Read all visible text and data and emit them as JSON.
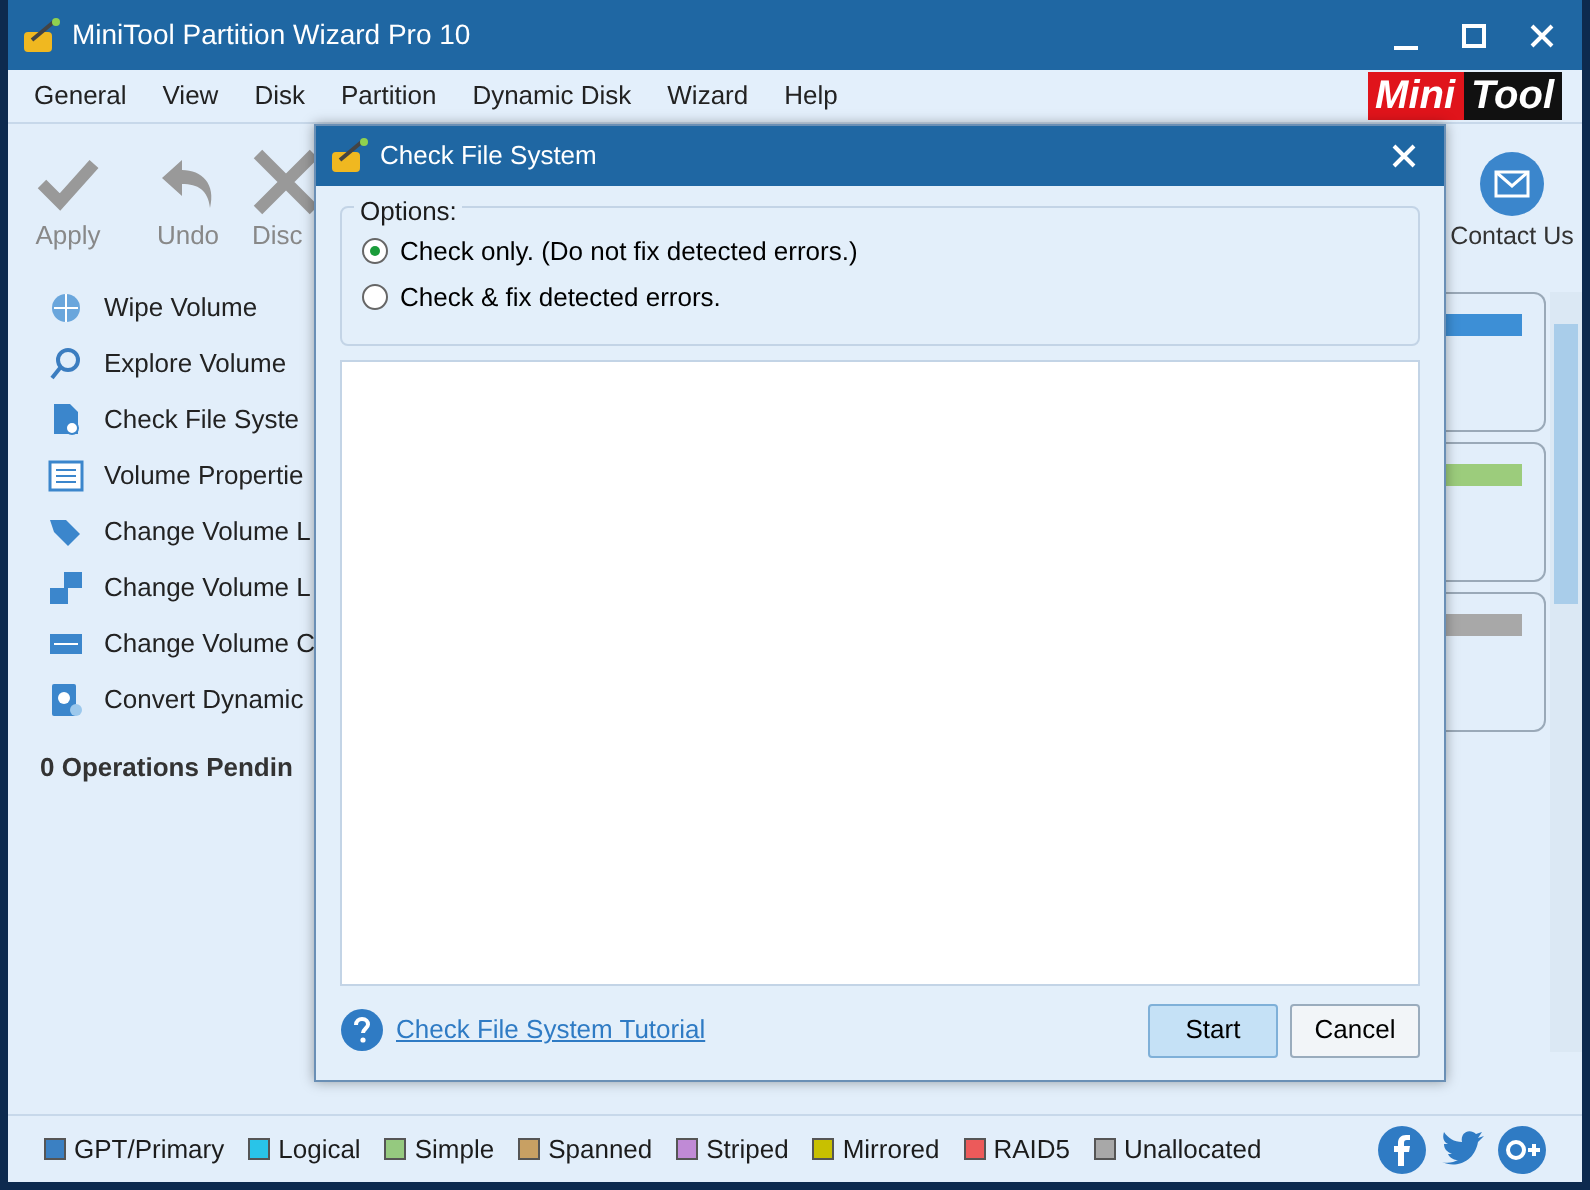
{
  "window": {
    "title": "MiniTool Partition Wizard Pro 10"
  },
  "menu": [
    "General",
    "View",
    "Disk",
    "Partition",
    "Dynamic Disk",
    "Wizard",
    "Help"
  ],
  "logo": {
    "left": "Mini",
    "right": "Tool"
  },
  "toolbar": [
    {
      "label": "Apply",
      "kind": "check"
    },
    {
      "label": "Undo",
      "kind": "undo"
    },
    {
      "label": "Disc",
      "kind": "discard"
    }
  ],
  "contact": {
    "label": "Contact Us"
  },
  "sidebar": {
    "items": [
      {
        "label": "Wipe Volume",
        "kind": "wipe"
      },
      {
        "label": "Explore Volume",
        "kind": "explore"
      },
      {
        "label": "Check File Syste",
        "kind": "check"
      },
      {
        "label": "Volume Propertie",
        "kind": "properties"
      },
      {
        "label": "Change Volume L",
        "kind": "label"
      },
      {
        "label": "Change Volume L",
        "kind": "letter"
      },
      {
        "label": "Change Volume C",
        "kind": "cluster"
      },
      {
        "label": "Convert Dynamic",
        "kind": "convert"
      }
    ],
    "pending": "0 Operations Pendin"
  },
  "disk_bars": [
    {
      "color": "#3d8fd6"
    },
    {
      "color": "#9ccc7c"
    },
    {
      "color": "#a8a8a8"
    }
  ],
  "dialog": {
    "title": "Check File System",
    "options_label": "Options:",
    "options": [
      {
        "label": "Check only. (Do not fix detected errors.)",
        "selected": true
      },
      {
        "label": "Check & fix detected errors.",
        "selected": false
      }
    ],
    "link": "Check File System Tutorial",
    "buttons": [
      {
        "label": "Start",
        "kind": "primary"
      },
      {
        "label": "Cancel",
        "kind": "secondary"
      }
    ]
  },
  "legend": [
    {
      "label": "GPT/Primary",
      "color": "#3b80c2"
    },
    {
      "label": "Logical",
      "color": "#29c4e8"
    },
    {
      "label": "Simple",
      "color": "#95c97f"
    },
    {
      "label": "Spanned",
      "color": "#c8a063"
    },
    {
      "label": "Striped",
      "color": "#c08ad6"
    },
    {
      "label": "Mirrored",
      "color": "#c8c000"
    },
    {
      "label": "RAID5",
      "color": "#ec5a5a"
    },
    {
      "label": "Unallocated",
      "color": "#a8a8a8"
    }
  ],
  "social": [
    {
      "kind": "facebook"
    },
    {
      "kind": "twitter"
    },
    {
      "kind": "googleplus"
    }
  ]
}
